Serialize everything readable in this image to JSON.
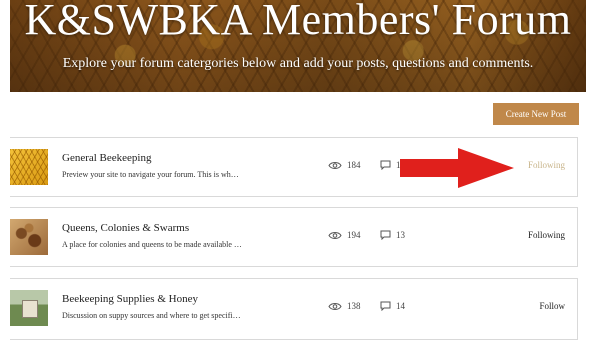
{
  "banner": {
    "title": "K&SWBKA Members' Forum",
    "subtitle": "Explore your forum catergories below and add your posts, questions and comments."
  },
  "create_post_label": "Create New Post",
  "categories": [
    {
      "title": "General Beekeeping",
      "description": "Preview your site to navigate your forum. This is wh…",
      "views": "184",
      "comments": "12",
      "follow_label": "Following",
      "follow_color": "#c8b48a"
    },
    {
      "title": "Queens, Colonies & Swarms",
      "description": "A place for colonies and queens to be made available …",
      "views": "194",
      "comments": "13",
      "follow_label": "Following",
      "follow_color": "#222222"
    },
    {
      "title": "Beekeeping Supplies & Honey",
      "description": "Discussion on suppy sources and where to get specifi…",
      "views": "138",
      "comments": "14",
      "follow_label": "Follow",
      "follow_color": "#222222"
    }
  ],
  "colors": {
    "accent_button": "#c0884a",
    "annotation_arrow": "#e0201c"
  }
}
